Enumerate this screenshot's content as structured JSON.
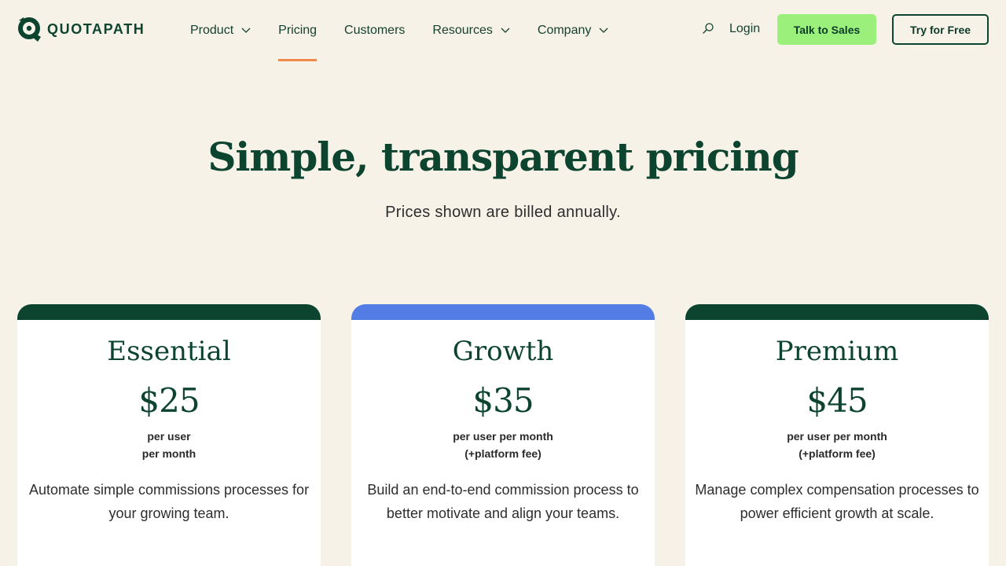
{
  "brand": {
    "name": "QUOTAPATH"
  },
  "colors": {
    "background": "#f6f2e8",
    "primary_green": "#0d4430",
    "accent_green": "#9bf07b",
    "accent_blue": "#537de4",
    "active_underline": "#ef8a4a"
  },
  "nav": {
    "items": [
      {
        "label": "Product",
        "has_dropdown": true,
        "active": false
      },
      {
        "label": "Pricing",
        "has_dropdown": false,
        "active": true
      },
      {
        "label": "Customers",
        "has_dropdown": false,
        "active": false
      },
      {
        "label": "Resources",
        "has_dropdown": true,
        "active": false
      },
      {
        "label": "Company",
        "has_dropdown": true,
        "active": false
      }
    ],
    "search_icon": "search-icon",
    "login_label": "Login",
    "sales_label": "Talk to Sales",
    "try_label": "Try for Free"
  },
  "hero": {
    "title": "Simple, transparent pricing",
    "subtitle": "Prices shown are billed annually."
  },
  "plans": [
    {
      "name": "Essential",
      "price": "$25",
      "unit_line1": "per user",
      "unit_line2": "per month",
      "description": "Automate simple commissions processes for your growing team.",
      "bar_color": "#0d4430"
    },
    {
      "name": "Growth",
      "price": "$35",
      "unit_line1": "per user per month",
      "unit_line2": "(+platform fee)",
      "description": "Build an end-to-end commission process to better motivate and align your teams.",
      "bar_color": "#537de4"
    },
    {
      "name": "Premium",
      "price": "$45",
      "unit_line1": "per user per month",
      "unit_line2": "(+platform fee)",
      "description": "Manage complex compensation processes to power efficient growth at scale.",
      "bar_color": "#0d4430"
    }
  ]
}
